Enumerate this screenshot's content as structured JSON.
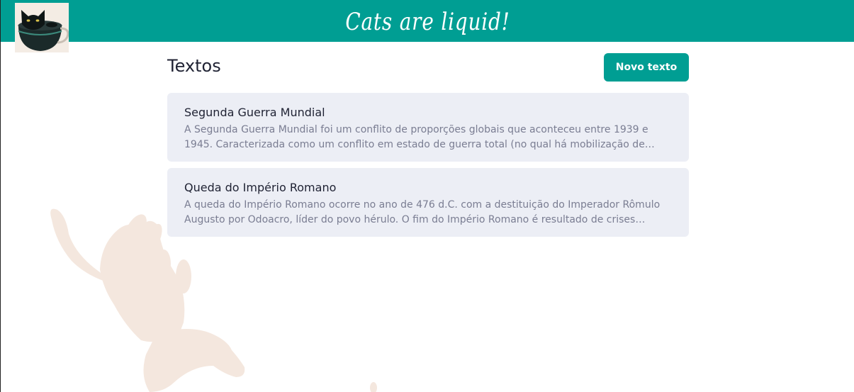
{
  "header": {
    "site_title": "Cats are liquid!",
    "logo_icon": "cat-in-cup-icon",
    "background_color": "#009e93"
  },
  "main": {
    "heading": "Textos",
    "new_text_button": "Novo texto",
    "accent_color": "#009e93",
    "texts": [
      {
        "title": "Segunda Guerra Mundial",
        "excerpt": "A Segunda Guerra Mundial foi um conflito de proporções globais que aconteceu entre 1939 e 1945. Caracterizada como um conflito em estado de guerra total (no qual há mobilização de…"
      },
      {
        "title": "Queda do Império Romano",
        "excerpt": "A queda do Império Romano ocorre no ano de 476 d.C. com a destituição do Imperador Rômulo Augusto por Odoacro, líder do povo hérulo. O fim do Império Romano é resultado de crises…"
      }
    ]
  },
  "decoration": {
    "background_icon": "cat-silhouette-icon",
    "color": "#f4e7de"
  }
}
